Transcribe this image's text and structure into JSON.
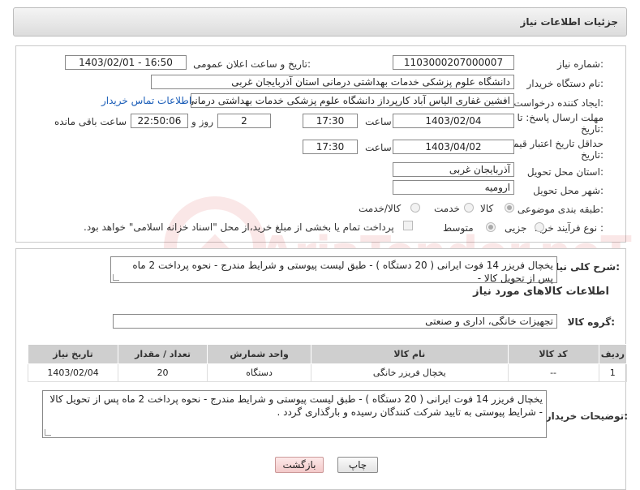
{
  "header": {
    "title": "جزئیات اطلاعات نیاز"
  },
  "form": {
    "need_number_label": "شماره نیاز:",
    "need_number_value": "1103000207000007",
    "announce_label": "تاریخ و ساعت اعلان عمومی:",
    "announce_value": "1403/02/01 - 16:50",
    "buyer_org_label": "نام دستگاه خریدار:",
    "buyer_org_value": "دانشگاه علوم پزشکی خدمات بهداشتی درمانی استان آذربایجان غربی",
    "creator_label": "ایجاد کننده درخواست:",
    "creator_value": "افشین غفاری الیاس آباد کارپرداز دانشگاه علوم پزشکی خدمات بهداشتی درمانی",
    "contact_link": "اطلاعات تماس خریدار",
    "deadline_label_1": "مهلت ارسال پاسخ: تا",
    "deadline_label_2": "تاریخ:",
    "deadline_date": "1403/02/04",
    "time_label": "ساعت",
    "deadline_time": "17:30",
    "days_value": "2",
    "days_label": "روز و",
    "remaining_time": "22:50:06",
    "remaining_label": "ساعت باقی مانده",
    "validity_label_1": "حداقل تاریخ اعتبار قیمت: تا",
    "validity_label_2": "تاریخ:",
    "validity_date": "1403/04/02",
    "validity_time": "17:30",
    "province_label": "استان محل تحویل:",
    "province_value": "آذربایجان غربی",
    "city_label": "شهر محل تحویل:",
    "city_value": "ارومیه",
    "category_label": "طبقه بندی موضوعی:",
    "category_options": [
      "کالا",
      "خدمت",
      "کالا/خدمت"
    ],
    "process_label": "نوع فرآیند خرید :",
    "process_options": [
      "جزیی",
      "متوسط"
    ],
    "process_payment_text": "پرداخت تمام یا بخشی از مبلغ خرید،از محل \"اسناد خزانه اسلامی\" خواهد بود."
  },
  "summary": {
    "label": "شرح کلی نیاز:",
    "text": "یخچال فریزر 14 فوت ایرانی ( 20 دستگاه ) - طبق لیست پیوستی و شرایط مندرج - نحوه پرداخت 2 ماه پس از تحویل کالا -"
  },
  "goods_info_title": "اطلاعات کالاهای مورد نیاز",
  "goods_group": {
    "label": "گروه کالا:",
    "value": "تجهیزات خانگی، اداری و صنعتی"
  },
  "table": {
    "headers": [
      "ردیف",
      "کد کالا",
      "نام کالا",
      "واحد شمارش",
      "تعداد / مقدار",
      "تاریخ نیاز"
    ],
    "rows": [
      [
        "1",
        "--",
        "یخچال فریزر خانگی",
        "دستگاه",
        "20",
        "1403/02/04"
      ]
    ]
  },
  "buyer_notes": {
    "label": "توضیحات خریدار:",
    "text": "یخچال فریزر 14 فوت ایرانی ( 20 دستگاه ) - طبق لیست پیوستی و شرایط مندرج - نحوه پرداخت 2 ماه پس از تحویل کالا - شرایط پیوستی به تایید شرکت کنندگان رسیده و بارگذاری گردد ."
  },
  "buttons": {
    "print": "چاپ",
    "back": "بازگشت"
  },
  "watermark": "AriaTender.neT"
}
